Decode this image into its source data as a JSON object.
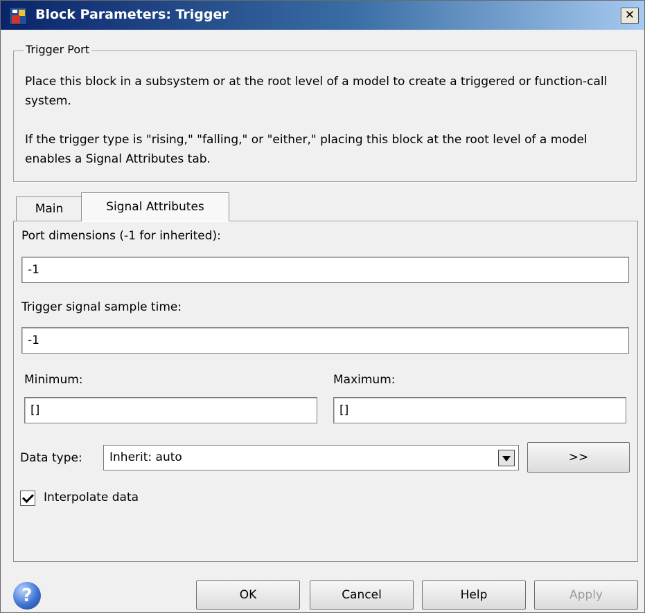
{
  "window": {
    "title": "Block Parameters: Trigger",
    "close_glyph": "✕"
  },
  "group": {
    "legend": "Trigger Port",
    "description_1": "Place this block in a subsystem or at the root level of a model to create a triggered or function-call system.",
    "description_2": "If the trigger type is \"rising,\" \"falling,\" or \"either,\" placing this block at the root level of a model enables a Signal Attributes tab."
  },
  "tabs": [
    {
      "label": "Main",
      "active": false
    },
    {
      "label": "Signal Attributes",
      "active": true
    }
  ],
  "fields": {
    "port_dimensions": {
      "label": "Port dimensions (-1 for inherited):",
      "value": "-1"
    },
    "sample_time": {
      "label": "Trigger signal sample time:",
      "value": "-1"
    },
    "minimum": {
      "label": "Minimum:",
      "value": "[]"
    },
    "maximum": {
      "label": "Maximum:",
      "value": "[]"
    },
    "data_type": {
      "label": "Data type:",
      "value": "Inherit: auto",
      "assistant_button": ">>"
    },
    "interpolate": {
      "label": "Interpolate data",
      "checked": true
    }
  },
  "buttons": {
    "ok": "OK",
    "cancel": "Cancel",
    "help": "Help",
    "apply": "Apply"
  },
  "icons": {
    "help": "help-question-icon",
    "app": "simulink-block-icon"
  },
  "colors": {
    "title_bar_start": "#0a246a",
    "dialog_bg": "#f0f0f0",
    "disabled_text": "#9a9a9a"
  }
}
